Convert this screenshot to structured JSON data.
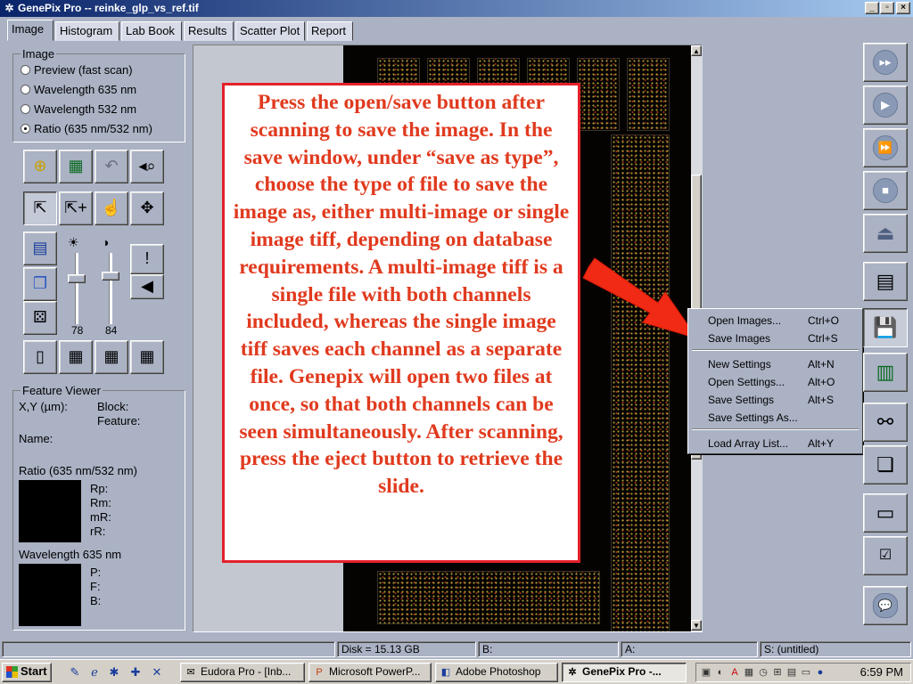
{
  "window": {
    "title": "GenePix Pro -- reinke_glp_vs_ref.tif",
    "controls": [
      "_",
      "▫",
      "×"
    ]
  },
  "tabs": [
    {
      "label": "Image",
      "active": true
    },
    {
      "label": "Histogram"
    },
    {
      "label": "Lab Book"
    },
    {
      "label": "Results"
    },
    {
      "label": "Scatter Plot"
    },
    {
      "label": "Report"
    }
  ],
  "image_group": {
    "legend": "Image",
    "options": [
      {
        "label": "Preview  (fast scan)",
        "checked": false
      },
      {
        "label": "Wavelength 635 nm",
        "checked": false
      },
      {
        "label": "Wavelength 532 nm",
        "checked": false
      },
      {
        "label": "Ratio (635 nm/532 nm)",
        "checked": true
      }
    ]
  },
  "sliders": {
    "brightness_value": "78",
    "contrast_value": "84",
    "brightness_level": 0.64,
    "contrast_level": 0.68
  },
  "feature_viewer": {
    "legend": "Feature Viewer",
    "xy_label": "X,Y (µm):",
    "block_label": "Block:",
    "feature_label": "Feature:",
    "name_label": "Name:",
    "ratio_label": "Ratio (635 nm/532 nm)",
    "ratio_stats": [
      "Rp:",
      "Rm:",
      "mR:",
      "rR:"
    ],
    "wavelength_label": "Wavelength 635 nm",
    "wavelength_stats": [
      "P:",
      "F:",
      "B:"
    ]
  },
  "callout_text": "Press the open/save button after scanning to save the image.  In the save window, under “save as type”, choose the type of file to save the image as, either multi-image or single image tiff, depending on database requirements.  A multi-image tiff is a single file with both channels included, whereas the single image tiff saves each channel as a separate file.  Genepix will open two files at once, so that both channels can be seen simultaneously.  After scanning, press the eject button to retrieve the slide.",
  "file_menu": {
    "items": [
      {
        "label": "Open Images...",
        "shortcut": "Ctrl+O"
      },
      {
        "label": "Save Images",
        "shortcut": "Ctrl+S"
      },
      {
        "label": "New Settings",
        "shortcut": "Alt+N"
      },
      {
        "label": "Open Settings...",
        "shortcut": "Alt+O"
      },
      {
        "label": "Save Settings",
        "shortcut": "Alt+S"
      },
      {
        "label": "Save Settings As...",
        "shortcut": ""
      },
      {
        "label": "Load Array List...",
        "shortcut": "Alt+Y"
      }
    ]
  },
  "statusbar": {
    "disk": "Disk = 15.13 GB",
    "b": "B:",
    "a": "A:",
    "settings": "S: (untitled)"
  },
  "taskbar": {
    "start_label": "Start",
    "tasks": [
      {
        "label": "Eudora Pro - [Inb...",
        "active": false
      },
      {
        "label": "Microsoft PowerP...",
        "active": false
      },
      {
        "label": "Adobe Photoshop",
        "active": false
      },
      {
        "label": "GenePix Pro -...",
        "active": true
      }
    ],
    "clock": "6:59 PM"
  },
  "colors": {
    "accent_red": "#e03a1e",
    "panel_bg": "#aab2c4",
    "titlebar": "#0a246a"
  }
}
